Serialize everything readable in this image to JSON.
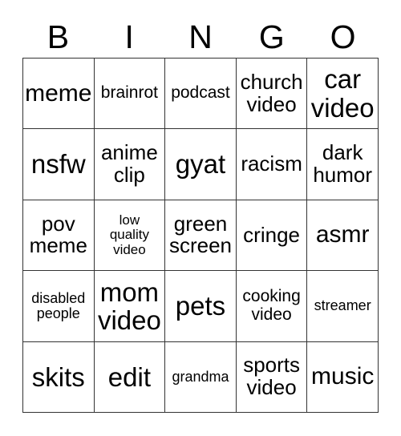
{
  "card": {
    "title": "BINGO",
    "header_letters": [
      "B",
      "I",
      "N",
      "G",
      "O"
    ],
    "colors": {
      "background": "#ffffff",
      "text": "#000000",
      "grid_line": "#333333"
    },
    "grid": {
      "columns": 5,
      "rows": 5,
      "cells": [
        {
          "text": "meme",
          "size": "lg"
        },
        {
          "text": "brainrot",
          "size": "sm"
        },
        {
          "text": "podcast",
          "size": "sm"
        },
        {
          "text": "church\nvideo",
          "size": "md"
        },
        {
          "text": "car\nvideo",
          "size": "xl"
        },
        {
          "text": "nsfw",
          "size": "xl"
        },
        {
          "text": "anime\nclip",
          "size": "md"
        },
        {
          "text": "gyat",
          "size": "xl"
        },
        {
          "text": "racism",
          "size": "md"
        },
        {
          "text": "dark\nhumor",
          "size": "md"
        },
        {
          "text": "pov\nmeme",
          "size": "md"
        },
        {
          "text": "low\nquality\nvideo",
          "size": "xxs"
        },
        {
          "text": "green\nscreen",
          "size": "md"
        },
        {
          "text": "cringe",
          "size": "md"
        },
        {
          "text": "asmr",
          "size": "lg"
        },
        {
          "text": "disabled\npeople",
          "size": "xs"
        },
        {
          "text": "mom\nvideo",
          "size": "xl"
        },
        {
          "text": "pets",
          "size": "xl"
        },
        {
          "text": "cooking\nvideo",
          "size": "sm"
        },
        {
          "text": "streamer",
          "size": "xs"
        },
        {
          "text": "skits",
          "size": "xl"
        },
        {
          "text": "edit",
          "size": "xl"
        },
        {
          "text": "grandma",
          "size": "xs"
        },
        {
          "text": "sports\nvideo",
          "size": "md"
        },
        {
          "text": "music",
          "size": "lg"
        }
      ]
    }
  }
}
